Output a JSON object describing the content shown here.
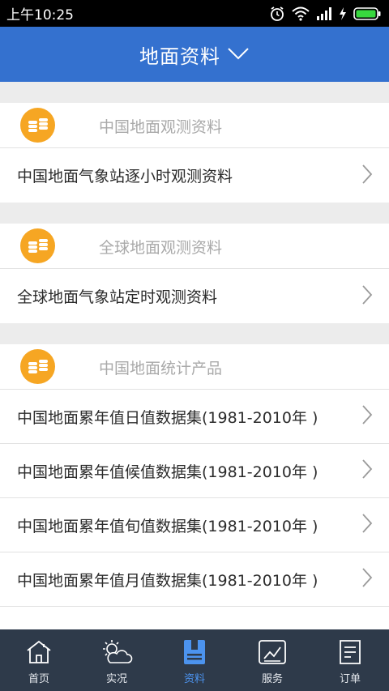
{
  "status_bar": {
    "time": "上午10:25"
  },
  "header": {
    "title": "地面资料"
  },
  "sections": [
    {
      "title": "中国地面观测资料",
      "items": [
        "中国地面气象站逐小时观测资料"
      ]
    },
    {
      "title": "全球地面观测资料",
      "items": [
        "全球地面气象站定时观测资料"
      ]
    },
    {
      "title": "中国地面统计产品",
      "items": [
        "中国地面累年值日值数据集(1981-2010年 )",
        "中国地面累年值候值数据集(1981-2010年 )",
        "中国地面累年值旬值数据集(1981-2010年 )",
        "中国地面累年值月值数据集(1981-2010年 )"
      ]
    }
  ],
  "tabs": [
    {
      "label": "首页",
      "icon": "home-icon",
      "active": false
    },
    {
      "label": "实况",
      "icon": "weather-icon",
      "active": false
    },
    {
      "label": "资料",
      "icon": "data-icon",
      "active": true
    },
    {
      "label": "服务",
      "icon": "service-icon",
      "active": false
    },
    {
      "label": "订单",
      "icon": "order-icon",
      "active": false
    }
  ],
  "colors": {
    "header_bg": "#3471cf",
    "tab_bar_bg": "#2e3a4a",
    "tab_active": "#4c93ee",
    "section_icon": "#f6a623"
  }
}
